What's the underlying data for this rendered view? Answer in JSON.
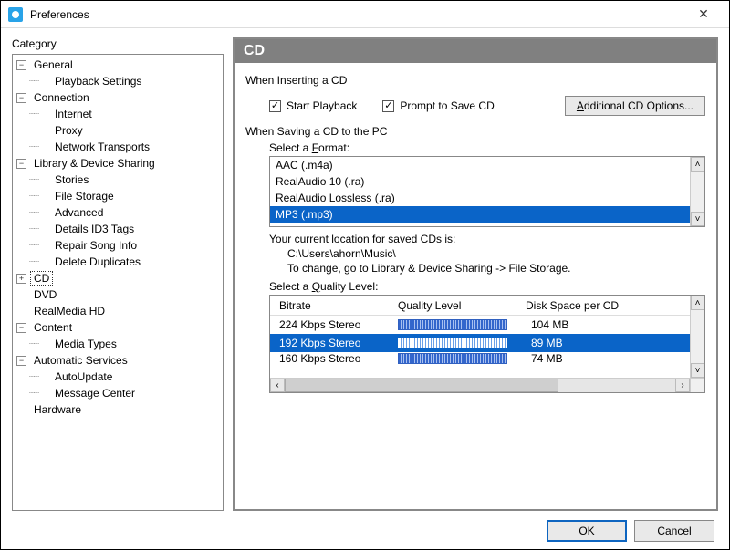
{
  "window": {
    "title": "Preferences"
  },
  "sidebar": {
    "label": "Category",
    "tree": {
      "general": "General",
      "playback_settings": "Playback Settings",
      "connection": "Connection",
      "internet": "Internet",
      "proxy": "Proxy",
      "network_transports": "Network Transports",
      "library_device_sharing": "Library & Device Sharing",
      "stories": "Stories",
      "file_storage": "File Storage",
      "advanced": "Advanced",
      "details_id3_tags": "Details ID3 Tags",
      "repair_song_info": "Repair Song Info",
      "delete_duplicates": "Delete Duplicates",
      "cd": "CD",
      "dvd": "DVD",
      "realmedia_hd": "RealMedia HD",
      "content": "Content",
      "media_types": "Media Types",
      "automatic_services": "Automatic Services",
      "autoupdate": "AutoUpdate",
      "message_center": "Message Center",
      "hardware": "Hardware"
    }
  },
  "panel": {
    "title": "CD",
    "insert_label": "When Inserting a CD",
    "start_playback": "Start Playback",
    "prompt_save": "Prompt to Save CD",
    "additional_options": "Additional CD Options...",
    "saving_label": "When Saving a CD to the PC",
    "select_format": "Select a Format:",
    "formats": {
      "aac": "AAC (.m4a)",
      "ra10": "RealAudio 10 (.ra)",
      "ra_lossless": "RealAudio Lossless (.ra)",
      "mp3": "MP3 (.mp3)"
    },
    "loc_label": "Your current location for saved CDs is:",
    "loc_path": "C:\\Users\\ahorn\\Music\\",
    "loc_hint": "To change, go to Library & Device Sharing -> File Storage.",
    "select_quality": "Select a Quality Level:",
    "quality_headers": {
      "bitrate": "Bitrate",
      "quality": "Quality Level",
      "disk": "Disk Space per CD"
    },
    "quality_rows": [
      {
        "bitrate": "224 Kbps Stereo",
        "disk": "104 MB"
      },
      {
        "bitrate": "192 Kbps Stereo",
        "disk": "89 MB"
      },
      {
        "bitrate": "160 Kbps Stereo",
        "disk": "74 MB"
      }
    ]
  },
  "footer": {
    "ok": "OK",
    "cancel": "Cancel"
  },
  "chart_data": {
    "type": "table",
    "title": "Select a Quality Level",
    "columns": [
      "Bitrate",
      "Quality Level",
      "Disk Space per CD"
    ],
    "rows": [
      [
        "224 Kbps Stereo",
        "high",
        "104 MB"
      ],
      [
        "192 Kbps Stereo",
        "high",
        "89 MB"
      ],
      [
        "160 Kbps Stereo",
        "high",
        "74 MB"
      ]
    ],
    "selected_index": 1
  }
}
